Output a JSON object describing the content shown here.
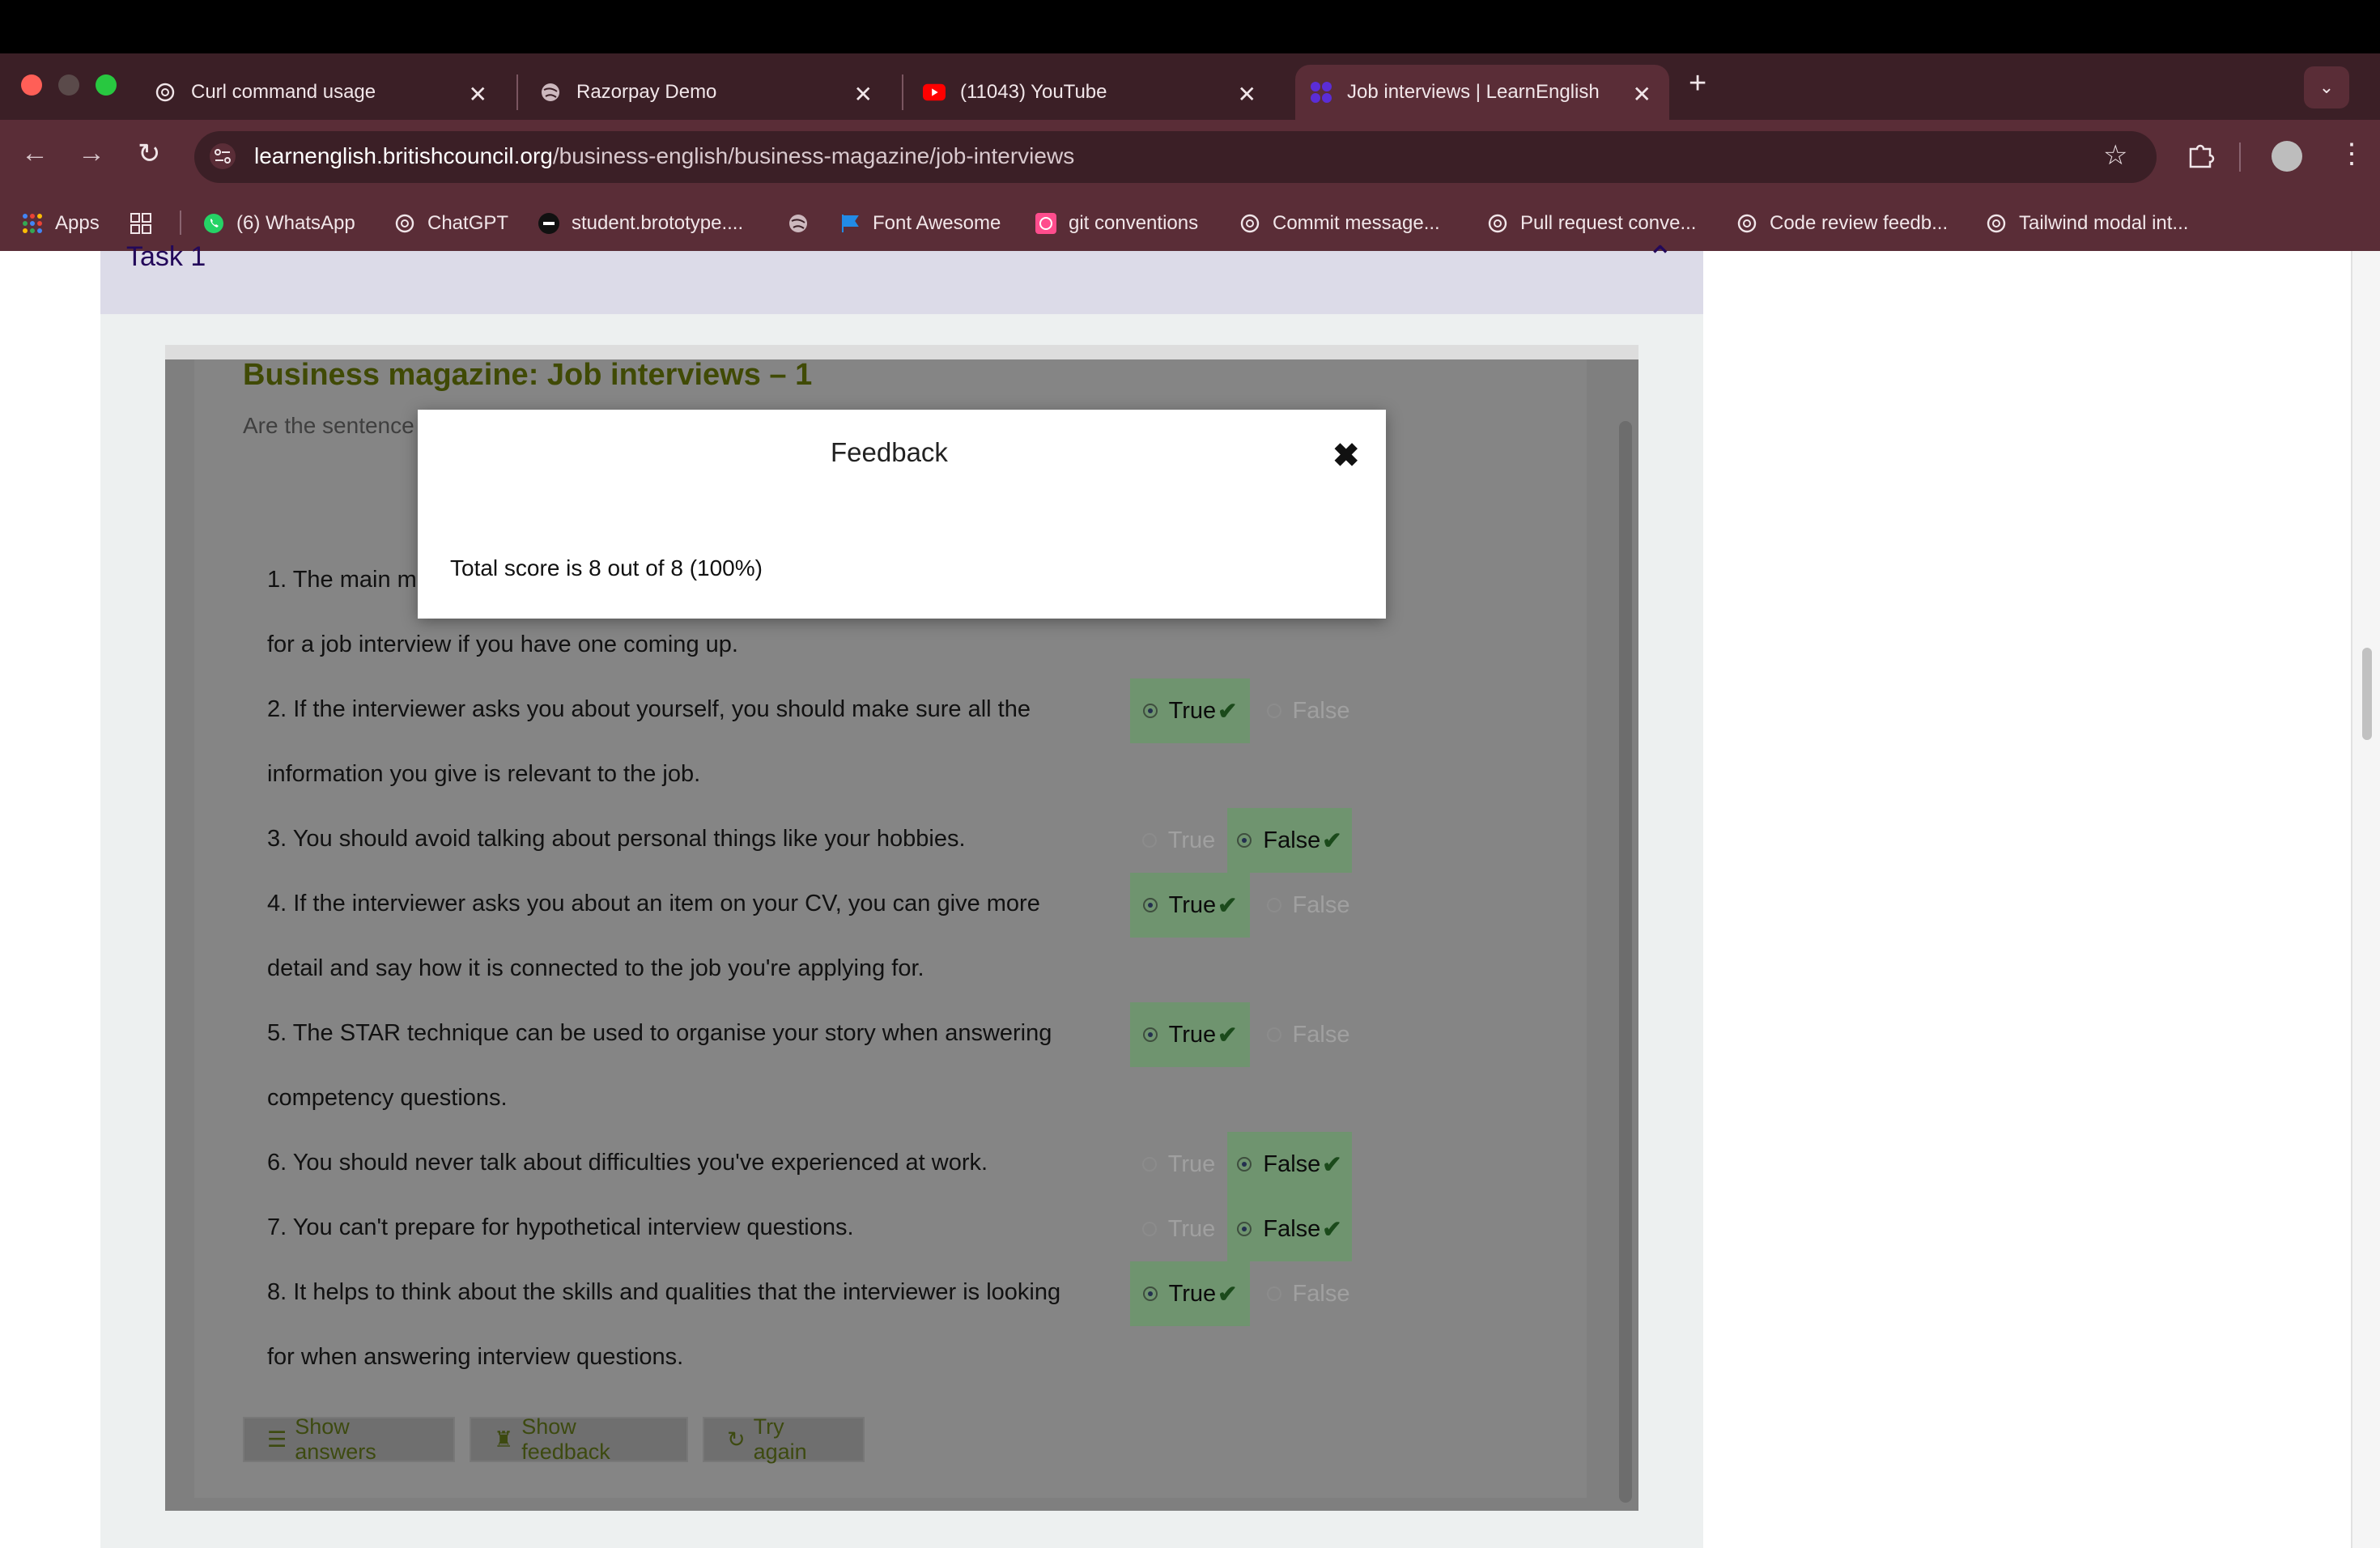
{
  "browser": {
    "tabs": [
      {
        "title": "Curl command usage",
        "icon": "chatgpt-icon",
        "active": false
      },
      {
        "title": "Razorpay Demo",
        "icon": "globe-icon",
        "active": false
      },
      {
        "title": "(11043) YouTube",
        "icon": "youtube-icon",
        "active": false
      },
      {
        "title": "Job interviews | LearnEnglish",
        "icon": "british-council-icon",
        "active": true
      }
    ],
    "new_tab": "+",
    "url_host": "learnenglish.britishcouncil.org",
    "url_path": "/business-english/business-magazine/job-interviews",
    "bookmarks": [
      {
        "label": "Apps",
        "icon": "apps-grid-icon"
      },
      {
        "label": "",
        "icon": "tab-groups-icon"
      },
      {
        "label": "(6) WhatsApp",
        "icon": "whatsapp-icon"
      },
      {
        "label": "ChatGPT",
        "icon": "chatgpt-icon"
      },
      {
        "label": "student.brototype....",
        "icon": "brototype-icon"
      },
      {
        "label": "",
        "icon": "globe-icon"
      },
      {
        "label": "Font Awesome",
        "icon": "flag-icon"
      },
      {
        "label": "git conventions",
        "icon": "pink-square-icon"
      },
      {
        "label": "Commit message...",
        "icon": "chatgpt-icon"
      },
      {
        "label": "Pull request conve...",
        "icon": "chatgpt-icon"
      },
      {
        "label": "Code review feedb...",
        "icon": "chatgpt-icon"
      },
      {
        "label": "Tailwind modal int...",
        "icon": "chatgpt-icon"
      }
    ]
  },
  "page": {
    "task_title": "Task 1",
    "exercise_title": "Business magazine: Job interviews – 1",
    "instructions_partial": "Are the sentence",
    "statements": [
      {
        "line1": "1. The main m",
        "line2": "for a job interview if you have one coming up.",
        "selected": "True"
      },
      {
        "line1": "2. If the interviewer asks you about yourself, you should make sure all the",
        "line2": "information you give is relevant to the job.",
        "selected": "True"
      },
      {
        "line1": "3. You should avoid talking about personal things like your hobbies.",
        "line2": "",
        "selected": "False"
      },
      {
        "line1": "4. If the interviewer asks you about an item on your CV, you can give more",
        "line2": "detail and say how it is connected to the job you're applying for.",
        "selected": "True"
      },
      {
        "line1": "5. The STAR technique can be used to organise your story when answering",
        "line2": "competency questions.",
        "selected": "True"
      },
      {
        "line1": "6. You should never talk about difficulties you've experienced at work.",
        "line2": "",
        "selected": "False"
      },
      {
        "line1": "7. You can't prepare for hypothetical interview questions.",
        "line2": "",
        "selected": "False"
      },
      {
        "line1": "8. It helps to think about the skills and qualities that the interviewer is looking",
        "line2": "for when answering interview questions.",
        "selected": "True"
      }
    ],
    "option_true": "True",
    "option_false": "False",
    "buttons": {
      "show_answers": "Show answers",
      "show_feedback": "Show feedback",
      "try_again": "Try again"
    }
  },
  "modal": {
    "title": "Feedback",
    "body": "Total score is 8 out of 8 (100%)"
  },
  "colors": {
    "correct_bg": "#6f946f",
    "title_green": "#404a05",
    "task_purple": "#23085a"
  }
}
